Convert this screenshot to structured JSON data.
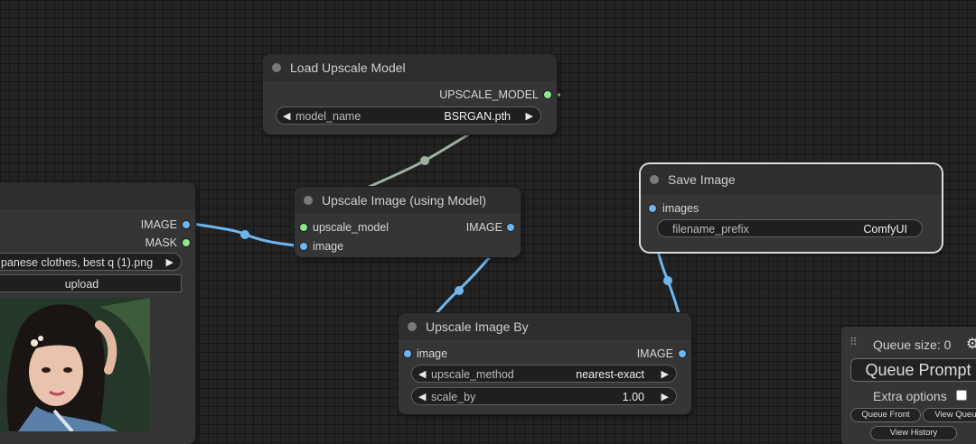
{
  "colors": {
    "canvas": "#232323",
    "node_body": "#353535",
    "node_title": "#2e2e2e",
    "slot_image": "#6fb6ef",
    "slot_model": "#8ee88e",
    "link_image": "#6fb6ef",
    "link_model": "#9fb29f"
  },
  "load_image": {
    "outputs": [
      "IMAGE",
      "MASK"
    ],
    "image_value": "panese clothes, best q (1).png",
    "upload_label": "upload"
  },
  "load_upscale_model": {
    "title": "Load Upscale Model",
    "output": "UPSCALE_MODEL",
    "model_name_label": "model_name",
    "model_name_value": "BSRGAN.pth"
  },
  "upscale_image_model": {
    "title": "Upscale Image (using Model)",
    "inputs": [
      "upscale_model",
      "image"
    ],
    "output": "IMAGE"
  },
  "upscale_image_by": {
    "title": "Upscale Image By",
    "input": "image",
    "output": "IMAGE",
    "method_label": "upscale_method",
    "method_value": "nearest-exact",
    "scale_label": "scale_by",
    "scale_value": "1.00"
  },
  "save_image": {
    "title": "Save Image",
    "input": "images",
    "prefix_label": "filename_prefix",
    "prefix_value": "ComfyUI"
  },
  "queue_panel": {
    "queue_size": "Queue size: 0",
    "queue_prompt": "Queue Prompt",
    "extra_options": "Extra options",
    "queue_front": "Queue Front",
    "view_queue": "View Queue",
    "view_history": "View History"
  },
  "arrow_left": "◀",
  "arrow_right": "▶",
  "gear_glyph": "⚙",
  "drag_glyph": "⠿"
}
